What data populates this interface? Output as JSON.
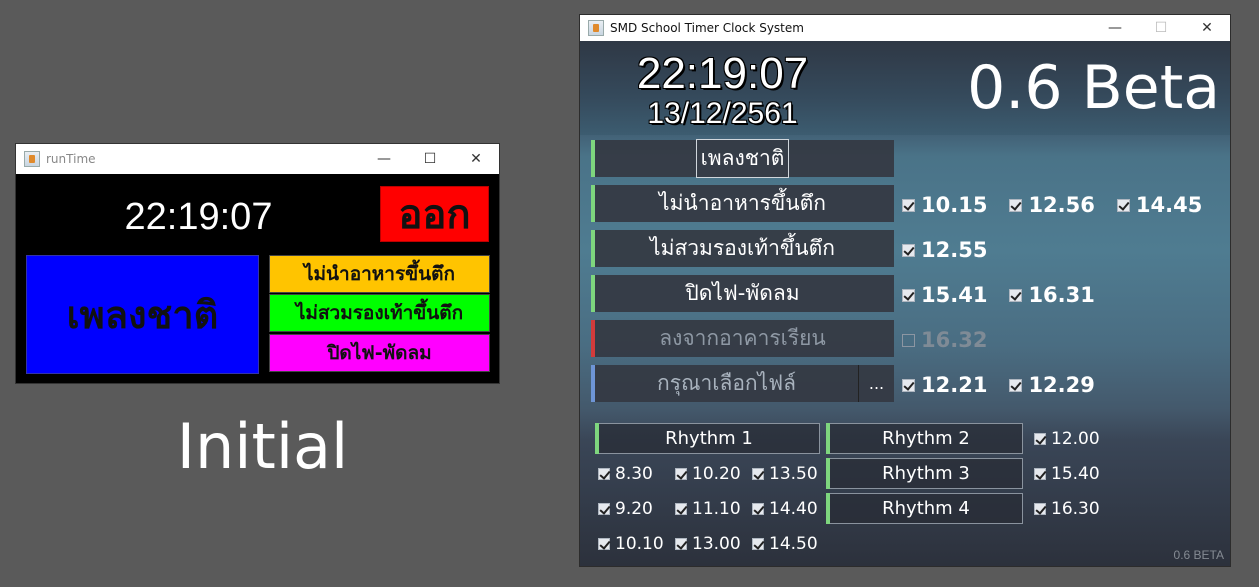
{
  "small_window": {
    "title": "runTime",
    "clock": "22:19:07",
    "exit_label": "ออก",
    "anthem_label": "เพลงชาติ",
    "buttons": [
      {
        "label": "ไม่นำอาหารขึ้นตึก",
        "color": "#ffc400"
      },
      {
        "label": "ไม่สวมรองเท้าขึ้นตึก",
        "color": "#00ff00"
      },
      {
        "label": "ปิดไฟ-พัดลม",
        "color": "#ff00ff"
      }
    ]
  },
  "caption": "Initial",
  "big_window": {
    "title": "SMD School Timer Clock System",
    "clock": "22:19:07",
    "date": "13/12/2561",
    "version": "0.6 Beta",
    "footer_version": "0.6 BETA",
    "rows": [
      {
        "label": "เพลงชาติ",
        "enabled": true,
        "times": []
      },
      {
        "label": "ไม่นำอาหารขึ้นตึก",
        "enabled": true,
        "times": [
          {
            "t": "10.15",
            "checked": true
          },
          {
            "t": "12.56",
            "checked": true
          },
          {
            "t": "14.45",
            "checked": true
          }
        ]
      },
      {
        "label": "ไม่สวมรองเท้าขึ้นตึก",
        "enabled": true,
        "times": [
          {
            "t": "12.55",
            "checked": true
          }
        ]
      },
      {
        "label": "ปิดไฟ-พัดลม",
        "enabled": true,
        "times": [
          {
            "t": "15.41",
            "checked": true
          },
          {
            "t": "16.31",
            "checked": true
          }
        ]
      },
      {
        "label": "ลงจากอาคารเรียน",
        "enabled": false,
        "times": [
          {
            "t": "16.32",
            "checked": false
          }
        ]
      },
      {
        "label": "กรุณาเลือกไฟล์",
        "enabled": true,
        "browse": "...",
        "times": [
          {
            "t": "12.21",
            "checked": true
          },
          {
            "t": "12.29",
            "checked": true
          }
        ]
      }
    ],
    "rhythms": {
      "r1": {
        "label": "Rhythm 1",
        "times": [
          "8.30",
          "10.20",
          "13.50",
          "9.20",
          "11.10",
          "14.40",
          "10.10",
          "13.00",
          "14.50"
        ]
      },
      "r2": {
        "label": "Rhythm 2",
        "time": "12.00"
      },
      "r3": {
        "label": "Rhythm 3",
        "time": "15.40"
      },
      "r4": {
        "label": "Rhythm 4",
        "time": "16.30"
      }
    }
  }
}
